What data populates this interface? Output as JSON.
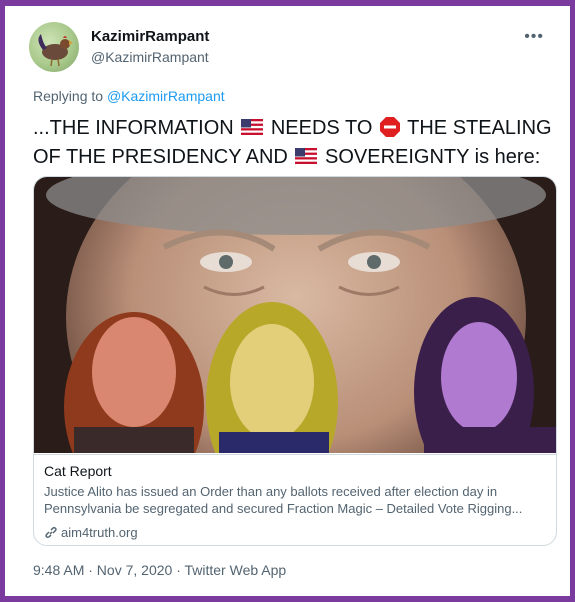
{
  "tweet": {
    "display_name": "KazimirRampant",
    "handle": "@KazimirRampant",
    "more_label": "•••",
    "reply_prefix": "Replying to ",
    "reply_mention": "@KazimirRampant",
    "text": {
      "part1": "...THE INFORMATION ",
      "part2": " NEEDS TO ",
      "part3": " THE STEALING OF THE PRESIDENCY AND ",
      "part4": " SOVEREIGNTY is here:"
    },
    "meta": "9:48 AM · Nov 7, 2020 · Twitter Web App"
  },
  "card": {
    "title": "Cat Report",
    "description": "Justice Alito has issued an Order than any ballots received after election day in Pennsylvania be segregated and secured Fraction Magic – Detailed Vote Rigging...",
    "link": "aim4truth.org"
  },
  "colors": {
    "frame": "#7a3a9e",
    "link": "#1d9bf0",
    "text": "#0f1419",
    "secondary": "#536471"
  }
}
